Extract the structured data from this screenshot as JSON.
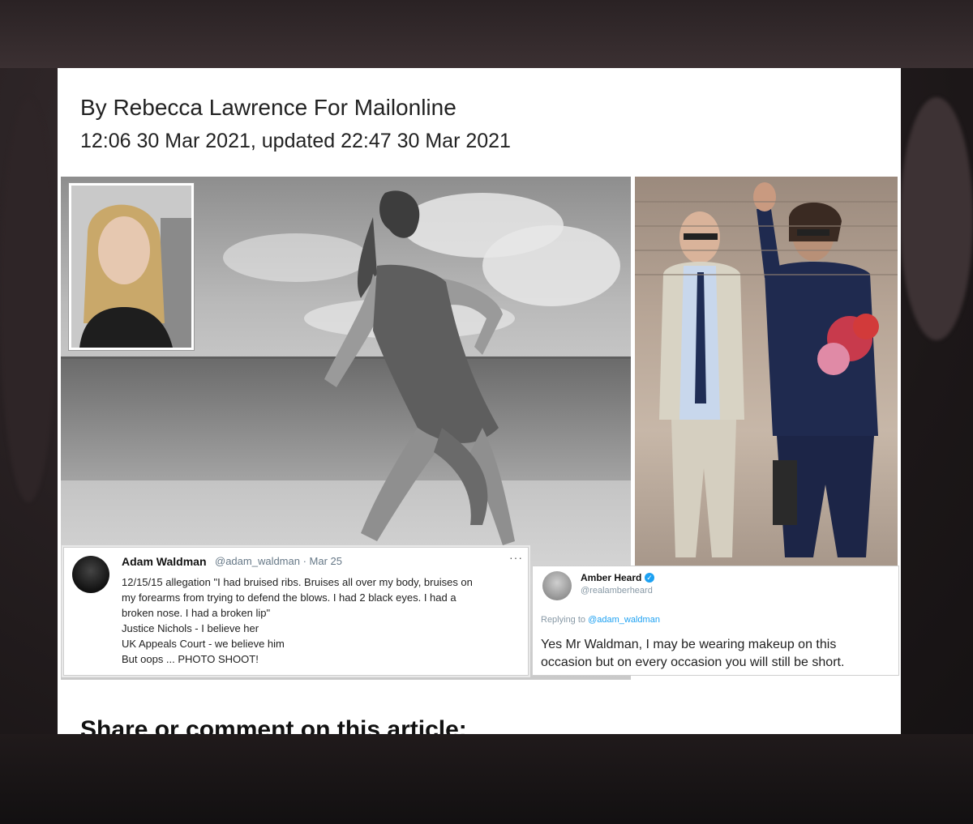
{
  "article": {
    "byline": "By Rebecca Lawrence For Mailonline",
    "dateline": "12:06 30 Mar 2021, updated 22:47 30 Mar 2021",
    "share_heading": "Share or comment on this article:"
  },
  "tweet_waldman": {
    "name": "Adam Waldman",
    "handle_date": "@adam_waldman · Mar 25",
    "more": "···",
    "lines": [
      "12/15/15 allegation \"I had bruised ribs. Bruises all over my body, bruises on",
      "my forearms from trying to defend the blows. I had 2 black eyes. I had a",
      "broken nose. I had a broken lip\"",
      "Justice Nichols - I believe her",
      "UK Appeals Court - we believe him",
      "But oops ... PHOTO SHOOT!"
    ]
  },
  "tweet_heard": {
    "name": "Amber Heard",
    "verified": "✓",
    "handle": "@realamberheard",
    "replying_prefix": "Replying to",
    "replying_handle": "@adam_waldman",
    "lines": [
      "Yes Mr Waldman, I may be wearing makeup on this",
      "occasion but on every occasion you will still be short."
    ]
  },
  "colors": {
    "twitter_blue": "#1da1f2",
    "page_bg": "#ffffff"
  }
}
